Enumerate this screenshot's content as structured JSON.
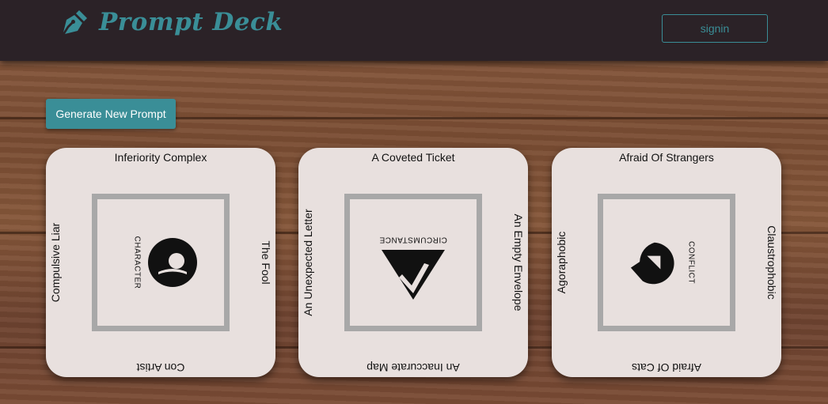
{
  "header": {
    "brand_title": "Prompt Deck",
    "brand_icon": "pen-nib-icon",
    "signin_label": "signin"
  },
  "actions": {
    "generate_label": "Generate New Prompt"
  },
  "colors": {
    "accent": "#3a8e97",
    "header_bg": "#2b2227",
    "card_bg": "#e8e0de",
    "frame": "#a8a8a8"
  },
  "cards": [
    {
      "type": "CHARACTER",
      "icon": "character-icon",
      "top": "Inferiority Complex",
      "left": "Compulsive Liar",
      "right": "The Fool",
      "bottom": "Con Artist"
    },
    {
      "type": "CIRCUMSTANCE",
      "icon": "circumstance-icon",
      "top": "A Coveted Ticket",
      "left": "An Unexpected Letter",
      "right": "An Empty Envelope",
      "bottom": "An Inaccurate Map"
    },
    {
      "type": "CONFLICT",
      "icon": "conflict-icon",
      "top": "Afraid Of Strangers",
      "left": "Agoraphobic",
      "right": "Claustrophobic",
      "bottom": "Afraid Of Cats"
    }
  ]
}
